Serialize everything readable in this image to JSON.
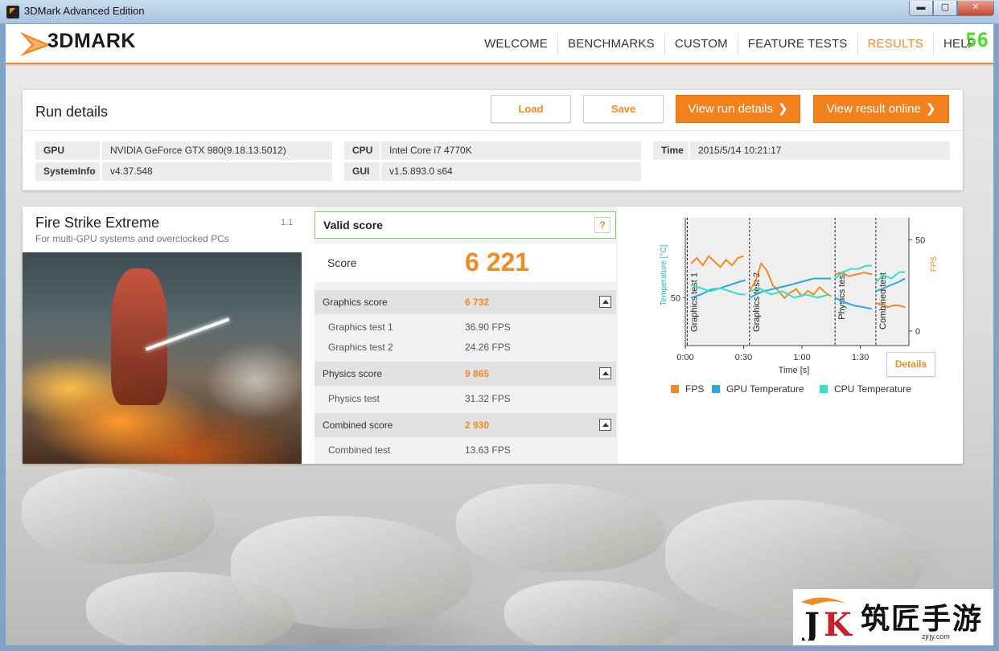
{
  "window": {
    "title": "3DMark Advanced Edition",
    "min": "▬",
    "max": "▢",
    "close": "✕"
  },
  "header": {
    "logo_text": "3DMARK",
    "nav": [
      "WELCOME",
      "BENCHMARKS",
      "CUSTOM",
      "FEATURE TESTS",
      "RESULTS",
      "HELP"
    ],
    "active": "RESULTS",
    "fps_overlay": "56"
  },
  "run_details": {
    "title": "Run details",
    "buttons": {
      "load": "Load",
      "save": "Save",
      "view_run": "View run details",
      "view_online": "View result online",
      "chev": "❯"
    },
    "info": {
      "gpu_label": "GPU",
      "gpu": "NVIDIA GeForce GTX 980(9.18.13.5012)",
      "sysinfo_label": "SystemInfo",
      "sysinfo": "v4.37.548",
      "cpu_label": "CPU",
      "cpu": "Intel Core i7 4770K",
      "gui_label": "GUI",
      "gui": "v1.5.893.0 s64",
      "time_label": "Time",
      "time": "2015/5/14 10:21:17"
    }
  },
  "result": {
    "test_name": "Fire Strike Extreme",
    "test_sub": "For multi-GPU systems and overclocked PCs",
    "version": "1.1",
    "valid": "Valid score",
    "help": "?",
    "score_label": "Score",
    "score": "6 221",
    "graphics": {
      "label": "Graphics score",
      "value": "6 732",
      "tests": [
        {
          "label": "Graphics test 1",
          "value": "36.90 FPS"
        },
        {
          "label": "Graphics test 2",
          "value": "24.26 FPS"
        }
      ]
    },
    "physics": {
      "label": "Physics score",
      "value": "9 865",
      "tests": [
        {
          "label": "Physics test",
          "value": "31.32 FPS"
        }
      ]
    },
    "combined": {
      "label": "Combined score",
      "value": "2 930",
      "tests": [
        {
          "label": "Combined test",
          "value": "13.63 FPS"
        }
      ]
    },
    "details": "Details"
  },
  "chart_data": {
    "type": "line",
    "xlabel": "Time [s]",
    "ylabel_left": "Temperature [°C]",
    "ylabel_right": "FPS",
    "x_ticks": [
      "0:00",
      "0:30",
      "1:00",
      "1:30"
    ],
    "y_left_ticks": [
      "50"
    ],
    "y_right_ticks": [
      "50",
      "0"
    ],
    "xlim": [
      0,
      115
    ],
    "ylim_left": [
      35,
      75
    ],
    "ylim_right": [
      -8,
      62
    ],
    "sections": [
      {
        "label": "Graphics test 1",
        "start": 1
      },
      {
        "label": "Graphics test 2",
        "start": 33
      },
      {
        "label": "Physics test",
        "start": 77
      },
      {
        "label": "Combined test",
        "start": 98
      }
    ],
    "series": [
      {
        "name": "FPS",
        "color": "#f08a24",
        "axis": "right",
        "segments": [
          {
            "x": [
              3,
              6,
              9,
              12,
              15,
              18,
              21,
              24,
              27,
              30
            ],
            "y": [
              37,
              40,
              36,
              41,
              38,
              35,
              39,
              36,
              40,
              41
            ]
          },
          {
            "x": [
              33,
              36,
              39,
              42,
              45,
              48,
              51,
              54,
              57,
              60,
              63,
              66,
              69,
              72,
              75
            ],
            "y": [
              22,
              27,
              37,
              33,
              25,
              22,
              18,
              21,
              23,
              19,
              22,
              20,
              24,
              21,
              19
            ]
          },
          {
            "x": [
              77,
              80,
              84,
              88,
              92,
              96
            ],
            "y": [
              31,
              32,
              30,
              31,
              32,
              31
            ]
          },
          {
            "x": [
              98,
              101,
              104,
              107,
              110,
              113
            ],
            "y": [
              15,
              15,
              13,
              14,
              14,
              13
            ]
          }
        ]
      },
      {
        "name": "GPU Temperature",
        "color": "#2aa8e0",
        "axis": "left",
        "segments": [
          {
            "x": [
              3,
              8,
              13,
              18,
              23,
              28,
              31
            ],
            "y": [
              50,
              51,
              52.5,
              53,
              54,
              55,
              55.5
            ]
          },
          {
            "x": [
              33,
              40,
              47,
              54,
              60,
              66,
              72,
              75
            ],
            "y": [
              50,
              52,
              53,
              54,
              55,
              56,
              56,
              56
            ]
          },
          {
            "x": [
              77,
              82,
              87,
              92,
              96
            ],
            "y": [
              50,
              48.5,
              47.5,
              47,
              46.5
            ]
          },
          {
            "x": [
              98,
              102,
              106,
              110,
              113
            ],
            "y": [
              52,
              53,
              54,
              55,
              56
            ]
          }
        ]
      },
      {
        "name": "CPU Temperature",
        "color": "#33e0c4",
        "axis": "left",
        "segments": [
          {
            "x": [
              3,
              8,
              13,
              18,
              23,
              28,
              31
            ],
            "y": [
              54,
              53,
              52,
              53,
              52,
              51,
              51
            ]
          },
          {
            "x": [
              33,
              38,
              44,
              50,
              56,
              62,
              68,
              74
            ],
            "y": [
              52,
              53,
              51,
              52,
              50,
              51,
              50,
              51
            ]
          },
          {
            "x": [
              77,
              81,
              85,
              89,
              93,
              96
            ],
            "y": [
              56,
              58,
              59,
              59,
              60,
              60
            ]
          },
          {
            "x": [
              98,
              102,
              106,
              110,
              113
            ],
            "y": [
              55,
              57,
              56,
              58,
              58
            ]
          }
        ]
      }
    ]
  },
  "watermark": {
    "text": "筑匠手游",
    "url": "zjrjy.com"
  }
}
